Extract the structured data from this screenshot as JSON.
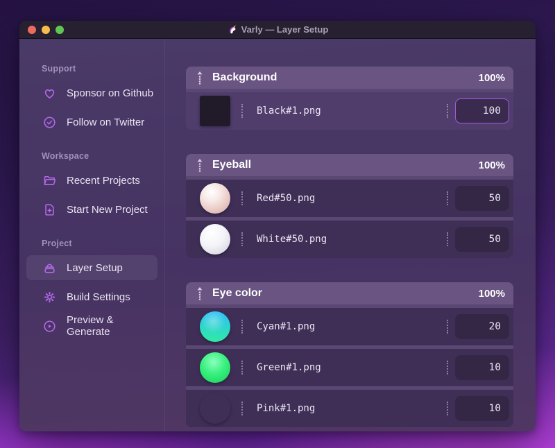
{
  "window": {
    "title": "Varly — Layer Setup",
    "app_icon": "unicorn-icon"
  },
  "sidebar": {
    "sections": [
      {
        "header": "Support",
        "items": [
          {
            "icon": "heart-icon",
            "label": "Sponsor on Github"
          },
          {
            "icon": "badge-check-icon",
            "label": "Follow on Twitter"
          }
        ]
      },
      {
        "header": "Workspace",
        "items": [
          {
            "icon": "folder-open-icon",
            "label": "Recent Projects"
          },
          {
            "icon": "file-plus-icon",
            "label": "Start New Project"
          }
        ]
      },
      {
        "header": "Project",
        "items": [
          {
            "icon": "layers-icon",
            "label": "Layer Setup",
            "active": true
          },
          {
            "icon": "gear-icon",
            "label": "Build Settings"
          },
          {
            "icon": "play-circle-icon",
            "label": "Preview & Generate"
          }
        ]
      }
    ]
  },
  "layers": {
    "groups": [
      {
        "name": "Background",
        "opacity": "100%",
        "rows": [
          {
            "thumbnail": "black-swatch",
            "thumb_color": "#211a28",
            "filename": "Black#1.png",
            "weight": "100",
            "focused": true
          }
        ]
      },
      {
        "name": "Eyeball",
        "opacity": "100%",
        "rows": [
          {
            "thumbnail": "red-sphere",
            "thumb_color": "#e6c2bc",
            "filename": "Red#50.png",
            "weight": "50"
          },
          {
            "thumbnail": "white-sphere",
            "thumb_color": "#f4f3f7",
            "filename": "White#50.png",
            "weight": "50"
          }
        ]
      },
      {
        "name": "Eye color",
        "opacity": "100%",
        "rows": [
          {
            "thumbnail": "cyan-sphere",
            "thumb_color": "#2bc2f2",
            "filename": "Cyan#1.png",
            "weight": "20"
          },
          {
            "thumbnail": "green-sphere",
            "thumb_color": "#38f07e",
            "filename": "Green#1.png",
            "weight": "10"
          },
          {
            "thumbnail": "pink-sphere",
            "thumb_color": "#e42bee",
            "filename": "Pink#1.png",
            "weight": "10"
          }
        ]
      }
    ]
  },
  "colors": {
    "accent": "#b468e9",
    "focus_border": "#a55ce8",
    "traffic_red": "#ed6a5f",
    "traffic_yellow": "#f5bd4f",
    "traffic_green": "#61c455"
  }
}
